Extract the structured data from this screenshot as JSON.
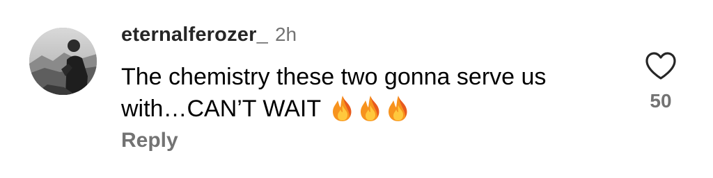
{
  "comment": {
    "author": "eternalferozer_",
    "time": "2h",
    "text_line_1": "The chemistry these two gonna serve us",
    "text_line_2": "with…CAN’T WAIT",
    "emoji_icons": [
      "fire-icon",
      "fire-icon",
      "fire-icon"
    ],
    "reply_label": "Reply",
    "like_icon": "heart-outline-icon",
    "like_count": "50"
  },
  "colors": {
    "secondary_text": "#737373",
    "primary_text": "#000000",
    "username": "#262626"
  }
}
